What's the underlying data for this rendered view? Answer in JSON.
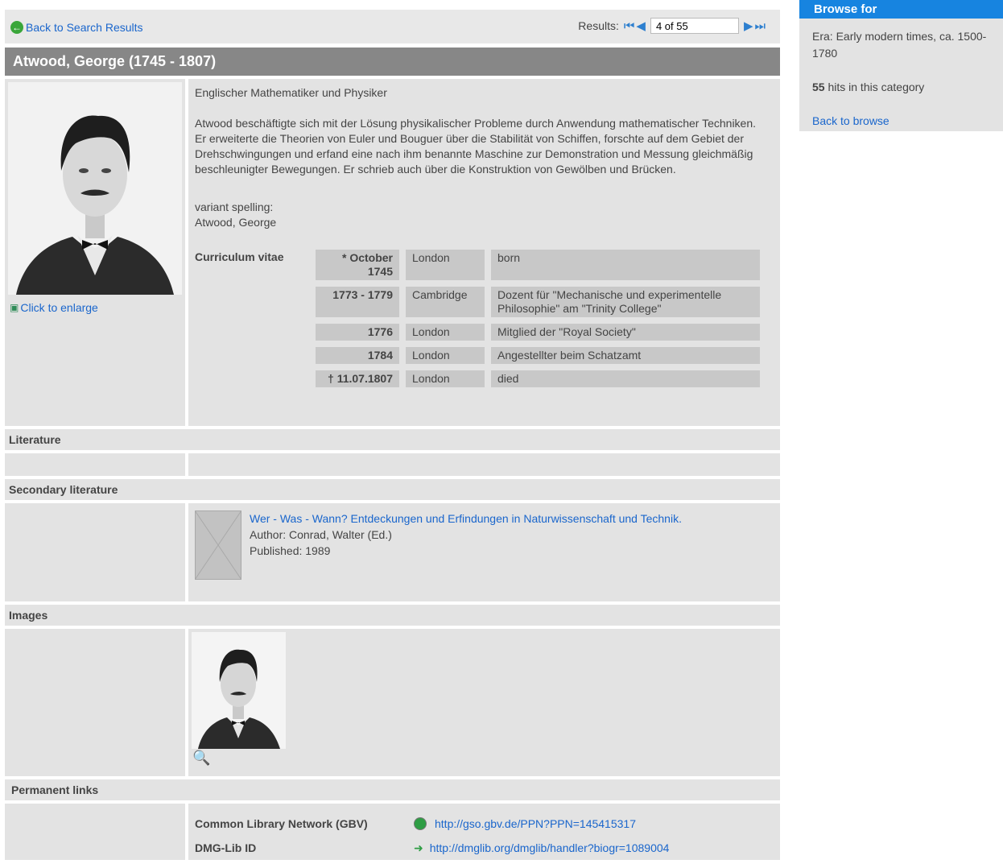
{
  "nav": {
    "back_label": "Back to Search Results",
    "results_label": "Results:",
    "record_position": "4 of 55"
  },
  "person": {
    "title": "Atwood, George (1745 - 1807)",
    "occupation": "Englischer Mathematiker und Physiker",
    "bio": "Atwood beschäftigte sich mit der Lösung physikalischer Probleme durch Anwendung mathematischer Techniken. Er erweiterte die Theorien von Euler und Bouguer über die Stabilität von Schiffen, forschte auf dem Gebiet der Drehschwingungen und erfand eine nach ihm benannte Maschine zur Demonstration und Messung gleichmäßig beschleunigter Bewegungen. Er schrieb auch über die Konstruktion von Gewölben und Brücken.",
    "variant_label": "variant spelling:",
    "variant_value": "Atwood, George",
    "enlarge_label": "Click to enlarge"
  },
  "curriculum": {
    "label": "Curriculum vitae",
    "rows": [
      {
        "date": "* October 1745",
        "place": "London",
        "event": "born"
      },
      {
        "date": "1773 - 1779",
        "place": "Cambridge",
        "event": "Dozent für \"Mechanische und experimentelle Philosophie\" am \"Trinity College\""
      },
      {
        "date": "1776",
        "place": "London",
        "event": "Mitglied der \"Royal Society\""
      },
      {
        "date": "1784",
        "place": "London",
        "event": "Angestellter beim Schatzamt"
      },
      {
        "date": "† 11.07.1807",
        "place": "London",
        "event": "died"
      }
    ]
  },
  "sections": {
    "literature": "Literature",
    "secondary": "Secondary literature",
    "images": "Images",
    "permalinks": "Permanent links"
  },
  "secondary_item": {
    "title": "Wer - Was - Wann? Entdeckungen und Erfindungen in Naturwissenschaft und Technik.",
    "author": "Author: Conrad, Walter (Ed.)",
    "published": "Published:  1989"
  },
  "permalinks": [
    {
      "label": "Common Library Network (GBV)",
      "url": "http://gso.gbv.de/PPN?PPN=145415317",
      "icon": "globe-icon"
    },
    {
      "label": "DMG-Lib ID",
      "url": "http://dmglib.org/dmglib/handler?biogr=1089004",
      "icon": "arrow-link-icon"
    }
  ],
  "sidebar": {
    "heading": "Browse for",
    "era": "Era: Early modern times, ca. 1500-1780",
    "hits_count": "55",
    "hits_text": " hits in this category",
    "back_label": "Back to browse"
  },
  "colors": {
    "accent": "#1784e0",
    "title_bar": "#878787",
    "panel": "#e3e3e3",
    "link": "#1a66cc"
  }
}
